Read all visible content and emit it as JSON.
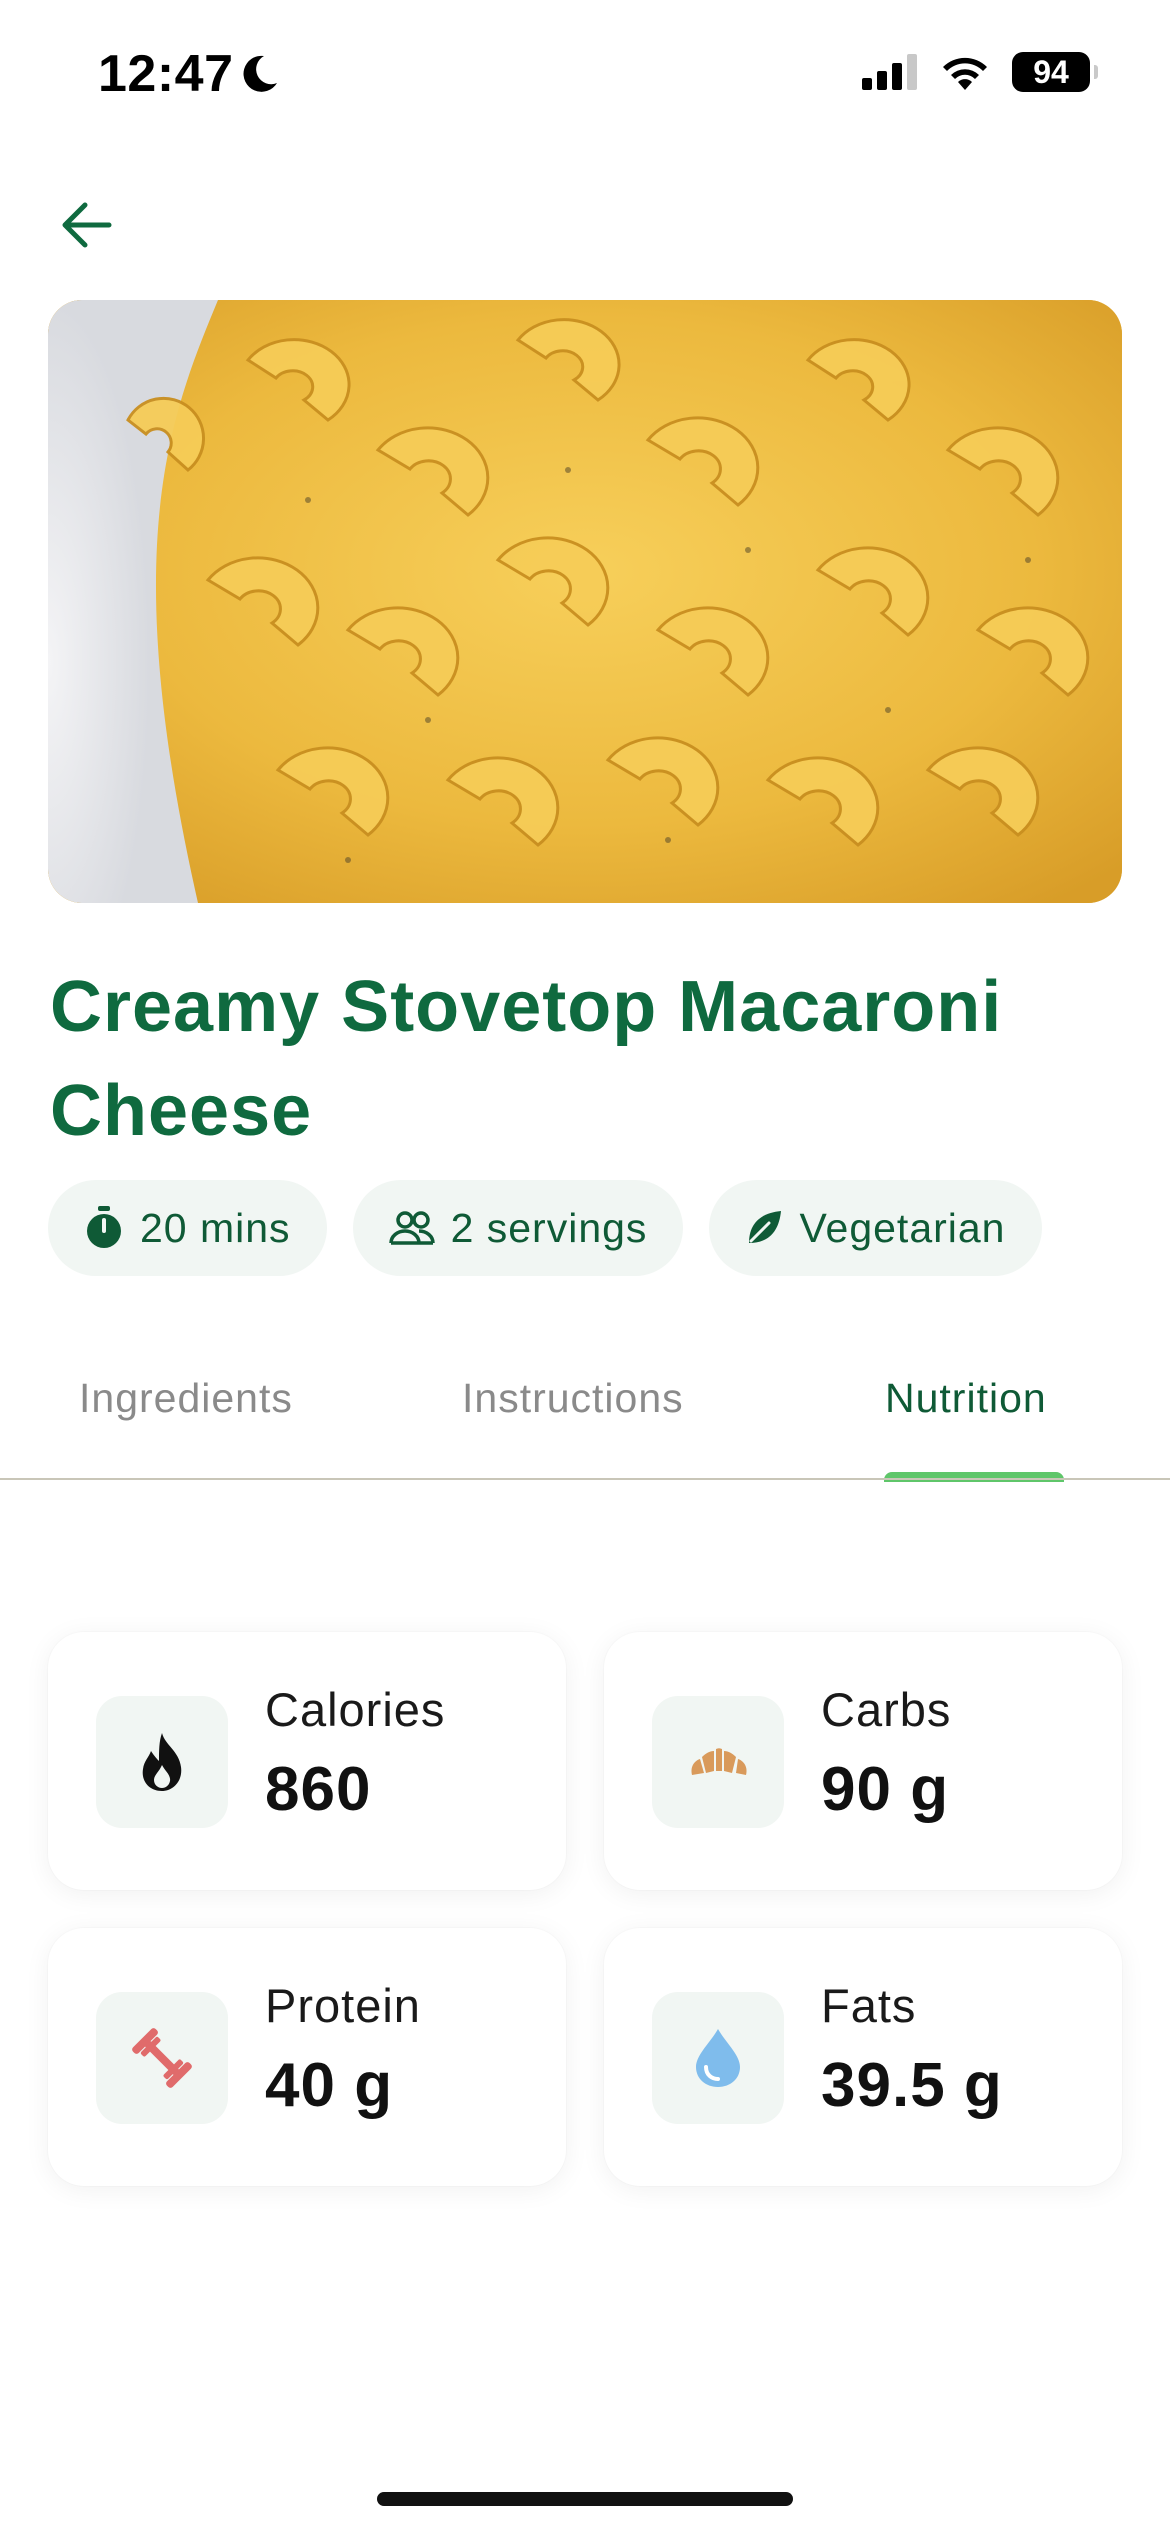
{
  "status_bar": {
    "time": "12:47",
    "battery": "94",
    "icons": [
      "moon-icon",
      "cellular-signal-icon",
      "wifi-icon",
      "battery-icon"
    ]
  },
  "nav": {
    "back_icon": "arrow-left-icon"
  },
  "recipe": {
    "title": "Creamy Stovetop Macaroni Cheese",
    "chips": [
      {
        "icon": "timer-icon",
        "label": "20 mins"
      },
      {
        "icon": "people-icon",
        "label": "2 servings"
      },
      {
        "icon": "leaf-icon",
        "label": "Vegetarian"
      }
    ]
  },
  "tabs": [
    {
      "label": "Ingredients",
      "active": false
    },
    {
      "label": "Instructions",
      "active": false
    },
    {
      "label": "Nutrition",
      "active": true
    }
  ],
  "nutrition": [
    {
      "label": "Calories",
      "value": "860",
      "icon": "flame-icon",
      "icon_color": "#111111"
    },
    {
      "label": "Carbs",
      "value": "90 g",
      "icon": "croissant-icon",
      "icon_color": "#d99a5b"
    },
    {
      "label": "Protein",
      "value": "40 g",
      "icon": "dumbbell-icon",
      "icon_color": "#e06b6b"
    },
    {
      "label": "Fats",
      "value": "39.5 g",
      "icon": "droplet-icon",
      "icon_color": "#7fbcec"
    }
  ],
  "colors": {
    "brand_green": "#0f6a3f",
    "tab_indicator": "#5fc66a",
    "chip_bg": "#f1f6f3"
  }
}
